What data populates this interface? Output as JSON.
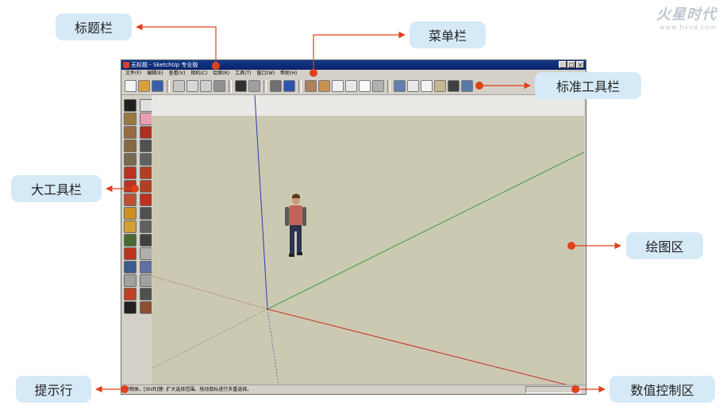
{
  "watermark": {
    "title": "火星时代",
    "subtitle": "www.hxsd.com"
  },
  "callouts": {
    "title_bar": "标题栏",
    "menu_bar": "菜单栏",
    "standard_toolbar": "标准工具栏",
    "large_toolbar": "大工具栏",
    "drawing_area": "绘图区",
    "prompt_line": "提示行",
    "vcb": "数值控制区"
  },
  "window": {
    "title": "无标题 - SketchUp 专业版",
    "controls": {
      "minimize": "_",
      "maximize": "□",
      "close": "×"
    },
    "menu": [
      "文件(F)",
      "编辑(E)",
      "查看(V)",
      "相机(C)",
      "绘图(R)",
      "工具(T)",
      "窗口(W)",
      "帮助(H)"
    ],
    "status_text": "择物体。[Shift]键: 扩大选择范围。拖动鼠标进行多重选择。",
    "standard_tools": [
      {
        "name": "new-icon",
        "color": "#f4f4f4"
      },
      {
        "name": "open-icon",
        "color": "#d8a040"
      },
      {
        "name": "save-icon",
        "color": "#3a5fa8"
      },
      {
        "sep": true
      },
      {
        "name": "cut-icon",
        "color": "#c8c8c8"
      },
      {
        "name": "copy-icon",
        "color": "#d8d8d8"
      },
      {
        "name": "paste-icon",
        "color": "#d0d0d0"
      },
      {
        "name": "erase-icon",
        "color": "#909090"
      },
      {
        "sep": true
      },
      {
        "name": "undo-icon",
        "color": "#303030"
      },
      {
        "name": "redo-icon",
        "color": "#a0a0a0"
      },
      {
        "sep": true
      },
      {
        "name": "print-icon",
        "color": "#707070"
      },
      {
        "name": "model-info-icon",
        "color": "#2d52b0"
      },
      {
        "sep": true
      },
      {
        "name": "iso-view-icon",
        "color": "#b08060"
      },
      {
        "name": "top-view-icon",
        "color": "#c89050"
      },
      {
        "name": "front-view-icon",
        "color": "#f0f0f0"
      },
      {
        "name": "right-view-icon",
        "color": "#e8e8e8"
      },
      {
        "name": "back-view-icon",
        "color": "#fafafa"
      },
      {
        "name": "left-view-icon",
        "color": "#b0b0b0"
      },
      {
        "sep": true
      },
      {
        "name": "xray-style-icon",
        "color": "#6080b0"
      },
      {
        "name": "wireframe-style-icon",
        "color": "#e8e8e8"
      },
      {
        "name": "hidden-line-style-icon",
        "color": "#f4f4f4"
      },
      {
        "name": "shaded-style-icon",
        "color": "#c8b890"
      },
      {
        "name": "textured-style-icon",
        "color": "#404040"
      },
      {
        "name": "monochrome-style-icon",
        "color": "#5878a8"
      }
    ],
    "large_tools": [
      {
        "name": "select-icon",
        "color": "#202020"
      },
      {
        "name": "make-component-icon",
        "color": "#e0e0e0"
      },
      {
        "name": "paint-bucket-icon",
        "color": "#9a7a40"
      },
      {
        "name": "eraser-icon",
        "color": "#e8a0b0"
      },
      {
        "name": "rectangle-icon",
        "color": "#9a6a40"
      },
      {
        "name": "line-icon",
        "color": "#b03020"
      },
      {
        "name": "circle-icon",
        "color": "#8a6a40"
      },
      {
        "name": "arc-icon",
        "color": "#505050"
      },
      {
        "name": "polygon-icon",
        "color": "#7a6a50"
      },
      {
        "name": "freehand-icon",
        "color": "#606060"
      },
      {
        "name": "move-icon",
        "color": "#c03020"
      },
      {
        "name": "push-pull-icon",
        "color": "#b04020"
      },
      {
        "name": "rotate-icon",
        "color": "#c03020"
      },
      {
        "name": "follow-me-icon",
        "color": "#b04020"
      },
      {
        "name": "scale-icon",
        "color": "#c05030"
      },
      {
        "name": "offset-icon",
        "color": "#c03020"
      },
      {
        "name": "tape-measure-icon",
        "color": "#d09020"
      },
      {
        "name": "dimension-icon",
        "color": "#505050"
      },
      {
        "name": "protractor-icon",
        "color": "#d0a030"
      },
      {
        "name": "text-icon",
        "color": "#606060"
      },
      {
        "name": "axes-icon",
        "color": "#4a6a30"
      },
      {
        "name": "3d-text-icon",
        "color": "#404040"
      },
      {
        "name": "orbit-icon",
        "color": "#c03020"
      },
      {
        "name": "pan-icon",
        "color": "#b0b0b0"
      },
      {
        "name": "zoom-icon",
        "color": "#3a5a90"
      },
      {
        "name": "zoom-window-icon",
        "color": "#6070a0"
      },
      {
        "name": "previous-view-icon",
        "color": "#a0a0a0"
      },
      {
        "name": "next-view-icon",
        "color": "#a0a0a0"
      },
      {
        "name": "position-camera-icon",
        "color": "#c04020"
      },
      {
        "name": "look-around-icon",
        "color": "#505050"
      },
      {
        "name": "walk-icon",
        "color": "#202020"
      },
      {
        "name": "section-plane-icon",
        "color": "#8a5030"
      }
    ]
  }
}
